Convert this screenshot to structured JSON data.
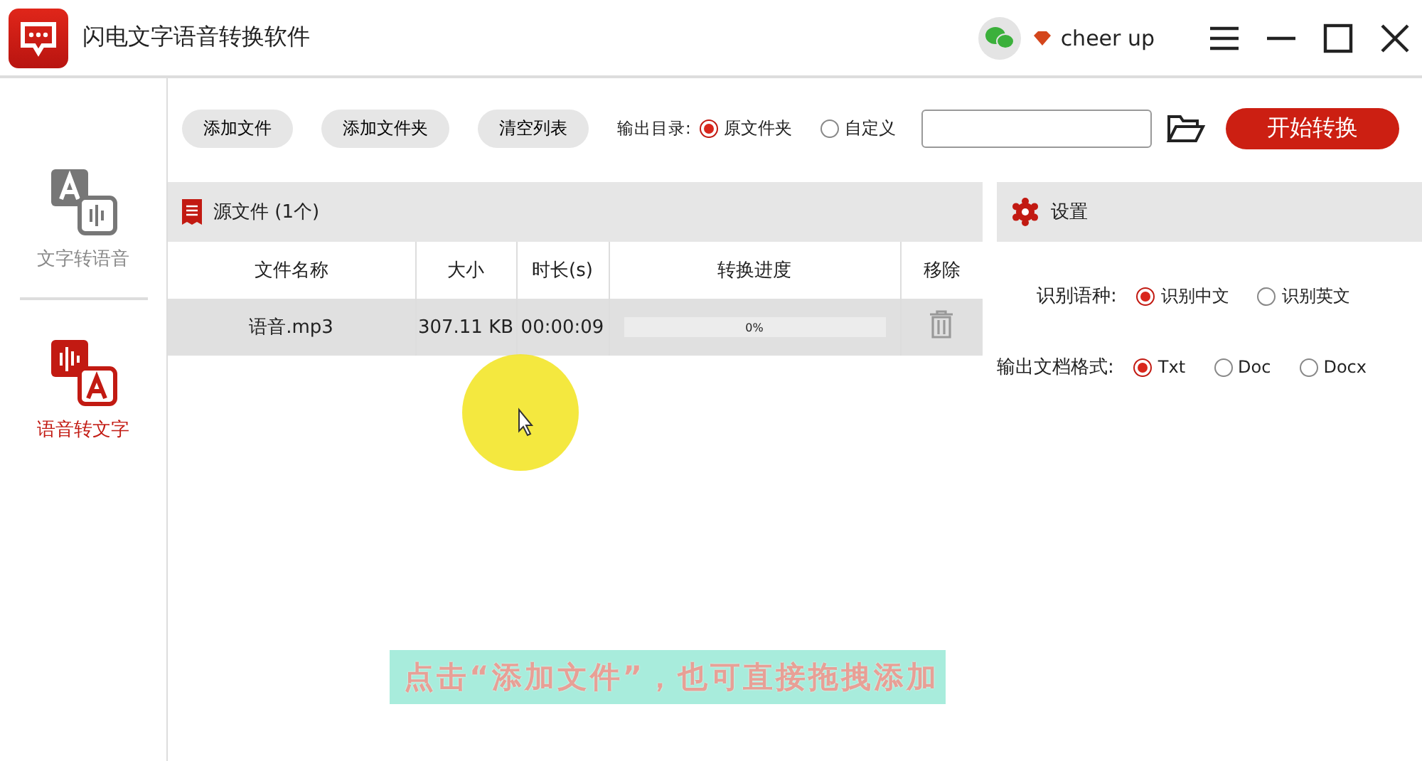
{
  "window": {
    "title": "闪电文字语音转换软件",
    "user": "cheer up"
  },
  "sidebar": {
    "items": [
      {
        "label": "文字转语音",
        "kind": "tts",
        "selected": false
      },
      {
        "label": "语音转文字",
        "kind": "stt",
        "selected": true
      }
    ]
  },
  "toolbar": {
    "buttons": [
      "添加文件",
      "添加文件夹",
      "清空列表"
    ],
    "output_label": "输出目录:",
    "output_options": [
      {
        "label": "原文件夹",
        "selected": true
      },
      {
        "label": "自定义",
        "selected": false
      }
    ],
    "start_button": "开始转换"
  },
  "files": {
    "title": "源文件 (1个)",
    "columns": [
      "文件名称",
      "大小",
      "时长(s)",
      "转换进度",
      "移除"
    ],
    "rows": [
      {
        "name": "语音.mp3",
        "size": "307.11 KB",
        "duration": "00:00:09",
        "level": 0,
        "reading": "0%",
        "selected": true
      }
    ]
  },
  "settings": {
    "title": "设置",
    "groups": [
      {
        "label": "识别语种:",
        "options": [
          {
            "label": "识别中文",
            "selected": true
          },
          {
            "label": "识别英文",
            "selected": false
          }
        ]
      },
      {
        "label": "输出文档格式:",
        "options": [
          {
            "label": "Txt",
            "selected": true
          },
          {
            "label": "Doc",
            "selected": false
          },
          {
            "label": "Docx",
            "selected": false
          }
        ]
      }
    ]
  },
  "caption": "点击“添加文件”，也可直接拖拽添加"
}
